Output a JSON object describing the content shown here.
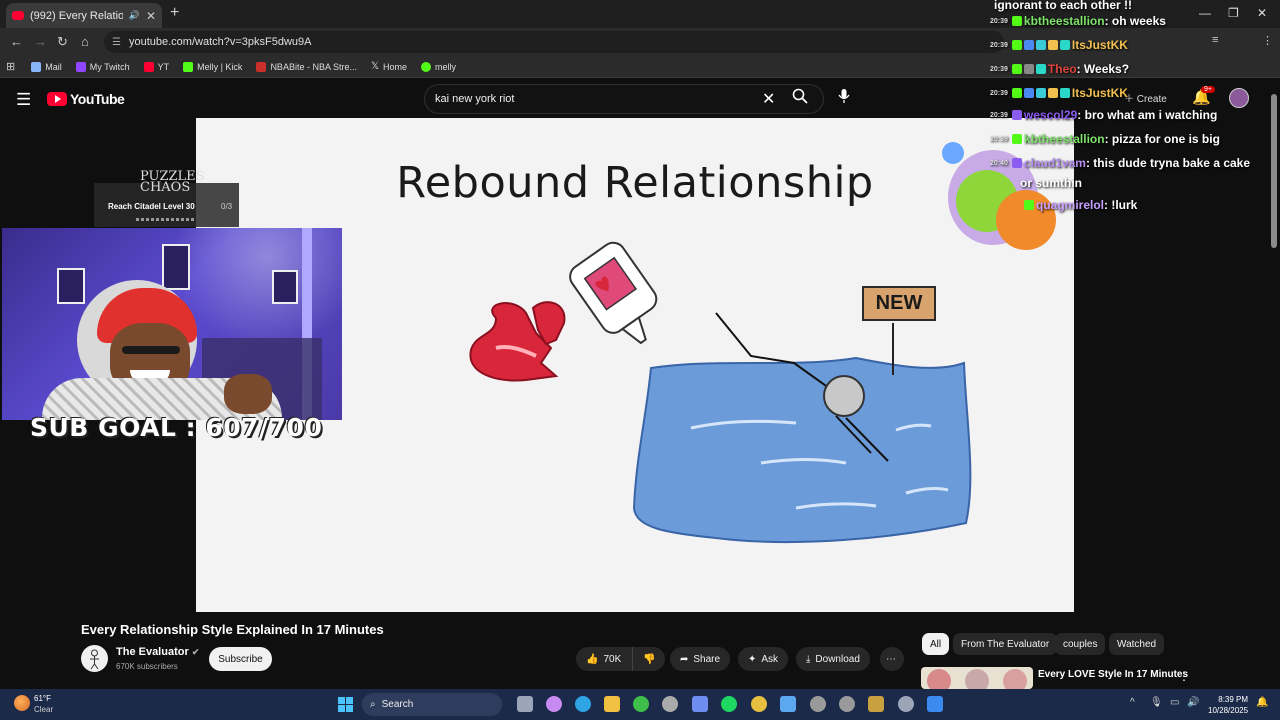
{
  "browser": {
    "tab_title": "(992) Every Relationship Style",
    "tab_audio_icon": "speaker-icon",
    "new_tab_label": "+",
    "url": "youtube.com/watch?v=3pksF5dwu9A",
    "bookmarks": [
      {
        "label": "Mail",
        "icon": "mail-icon",
        "color": "#8ab4f8"
      },
      {
        "label": "My Twitch",
        "icon": "twitch-icon",
        "color": "#9146ff"
      },
      {
        "label": "YT",
        "icon": "youtube-icon",
        "color": "#ff0033"
      },
      {
        "label": "Melly | Kick",
        "icon": "kick-icon",
        "color": "#53fc18"
      },
      {
        "label": "NBABite - NBA Stre...",
        "icon": "nba-icon",
        "color": "#c9302c"
      },
      {
        "label": "Home",
        "icon": "x-icon",
        "color": "#ffffff"
      },
      {
        "label": "melly",
        "icon": "melly-icon",
        "color": "#53fc18"
      }
    ]
  },
  "youtube": {
    "logo_text": "YouTube",
    "search_value": "kai new york riot",
    "create_label": "Create",
    "notifications_badge": "9+"
  },
  "video": {
    "frame_title": "Rebound Relationship",
    "sign_text": "NEW",
    "title": "Every Relationship Style Explained In 17 Minutes",
    "channel": "The Evaluator",
    "subscribers": "670K subscribers",
    "subscribe_label": "Subscribe",
    "likes": "70K",
    "share_label": "Share",
    "ask_label": "Ask",
    "download_label": "Download"
  },
  "stream_overlay": {
    "game_logo": "PUZZLES CHAOS",
    "game_task": "Reach Citadel Level 30",
    "game_progress": "0/3",
    "sub_goal": "SUB GOAL : 607/700"
  },
  "chat": [
    {
      "time": "",
      "user": "",
      "color": "#ffffff",
      "msg": "ignorant to each other !!"
    },
    {
      "time": "20:39",
      "user": "kbtheestallion",
      "color": "#7fe36b",
      "msg": ": oh weeks"
    },
    {
      "time": "20:39",
      "user": "ItsJustKK",
      "color": "#f2c14e",
      "msg": ""
    },
    {
      "time": "20:39",
      "user": "Theo",
      "color": "#e0443a",
      "msg": ": Weeks?"
    },
    {
      "time": "20:39",
      "user": "ItsJustKK",
      "color": "#f2c14e",
      "msg": ": bro what am i watching"
    },
    {
      "time": "20:39",
      "user": "wescol29",
      "color": "#8a5cf0",
      "msg": ": pizza for one is big"
    },
    {
      "time": "20:39",
      "user": "kbtheestallion",
      "color": "#7fe36b",
      "msg": ": pizza for one is big"
    },
    {
      "time": "20:40",
      "user": "claud1vam",
      "color": "#b58cf0",
      "msg": ": this dude tryna bake a cake"
    },
    {
      "time": "",
      "user": "",
      "color": "#ffffff",
      "msg": "or sumthin"
    },
    {
      "time": "",
      "user": "quagmirelol",
      "color": "#c8a0ff",
      "msg": ": !lurk"
    }
  ],
  "recommendations": {
    "chips": [
      "All",
      "From The Evaluator",
      "couples",
      "Watched"
    ],
    "first_title": "Every LOVE Style In 17 Minutes"
  },
  "taskbar": {
    "temperature": "61°F",
    "condition": "Clear",
    "search_label": "Search",
    "time": "8:39 PM",
    "date": "10/28/2025",
    "apps": [
      {
        "icon": "file-explorer-icon",
        "color": "#9aa5b8"
      },
      {
        "icon": "copilot-icon",
        "color": "#c78af0"
      },
      {
        "icon": "edge-icon",
        "color": "#2ea6e6"
      },
      {
        "icon": "folder-icon",
        "color": "#f0c040"
      },
      {
        "icon": "xbox-icon",
        "color": "#3dbf4a"
      },
      {
        "icon": "settings-icon",
        "color": "#aaaaaa"
      },
      {
        "icon": "store-icon",
        "color": "#6b8ef0"
      },
      {
        "icon": "spotify-icon",
        "color": "#1ed760"
      },
      {
        "icon": "chrome-icon",
        "color": "#e8c040"
      },
      {
        "icon": "photos-icon",
        "color": "#5ba8f0"
      },
      {
        "icon": "media-icon",
        "color": "#9a9a9a"
      },
      {
        "icon": "app-icon",
        "color": "#9a9a9a"
      },
      {
        "icon": "app-icon",
        "color": "#c8a040"
      },
      {
        "icon": "gear-icon",
        "color": "#9aa5b8"
      },
      {
        "icon": "app-icon",
        "color": "#3a8af0"
      }
    ]
  }
}
